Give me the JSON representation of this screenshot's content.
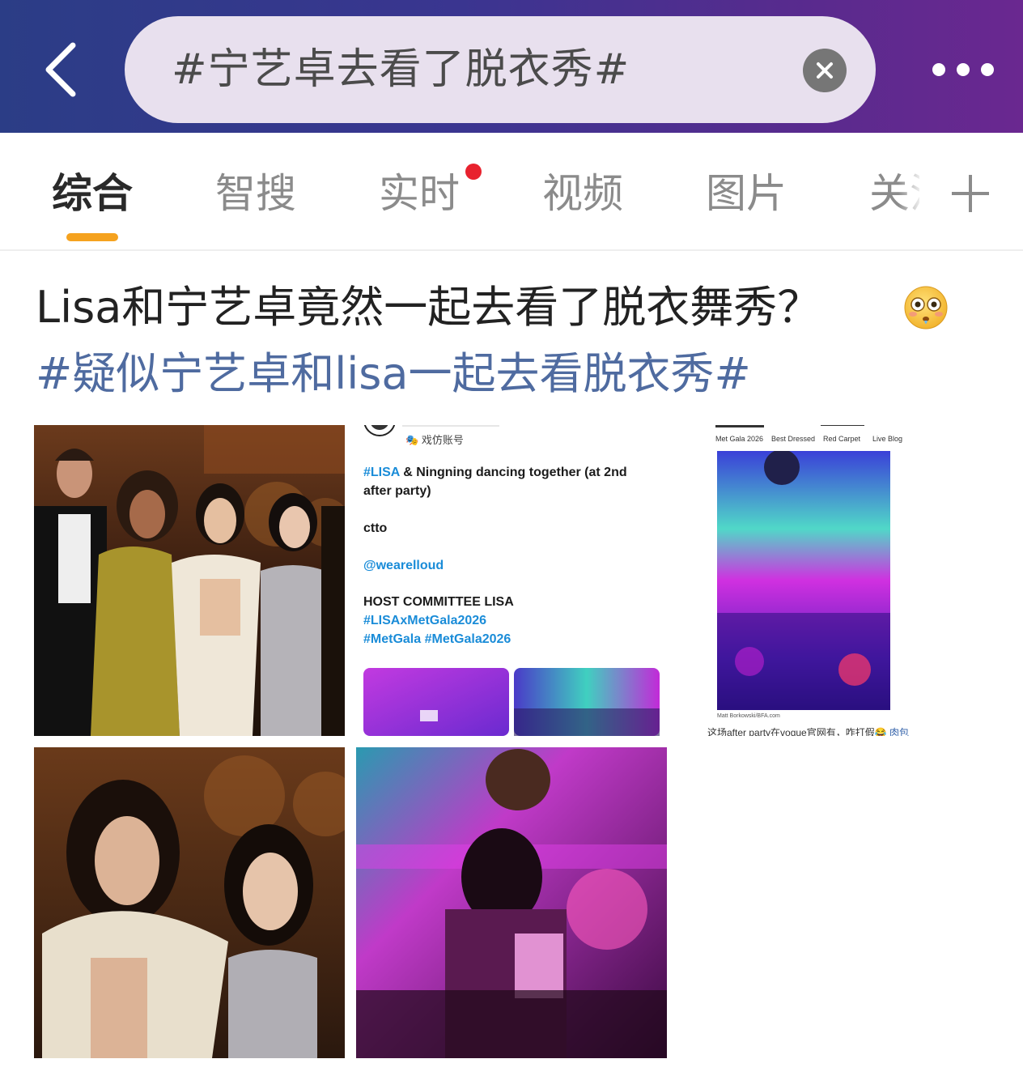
{
  "header": {
    "search_query": "#宁艺卓去看了脱衣秀#"
  },
  "tabs": [
    {
      "label": "综合"
    },
    {
      "label": "智搜"
    },
    {
      "label": "实时"
    },
    {
      "label": "视频"
    },
    {
      "label": "图片"
    },
    {
      "label": "关注"
    }
  ],
  "colors": {
    "header_gradient_start": "#2b3d86",
    "header_gradient_end": "#6a2890",
    "tab_indicator": "#f5a21f",
    "hashtag": "#4f6ba0",
    "notification_dot": "#e8222e"
  },
  "icons": {
    "back": "back-chevron-icon",
    "clear": "clear-x-icon",
    "more": "more-dots-icon",
    "add_tab": "plus-icon",
    "emoji": "flushed-face-emoji"
  },
  "post": {
    "title": "Lisa和宁艺卓竟然一起去看了脱衣舞秀？",
    "hashtag": "#疑似宁艺卓和lisa一起去看脱衣秀#"
  },
  "tweet_image": {
    "account_label": "戏仿账号",
    "line1_tag": "#LISA",
    "line1_rest": " & Ningning dancing together (at 2nd",
    "line2": "after party)",
    "line3": "ctto",
    "line4": "@wearelloud",
    "line5": "HOST COMMITTEE LISA",
    "line6": "#LISAxMetGala2026",
    "line7": "#MetGala #MetGala2026"
  },
  "vogue_image": {
    "nav": [
      "Met Gala 2026",
      "Best Dressed",
      "Red Carpet",
      "Live Blog"
    ],
    "photo_credit": "Matt Borkowski/BFA.com",
    "caption_text": "这场after party在vogue官网有，咋打假😂 ",
    "caption_link": "肉包"
  }
}
